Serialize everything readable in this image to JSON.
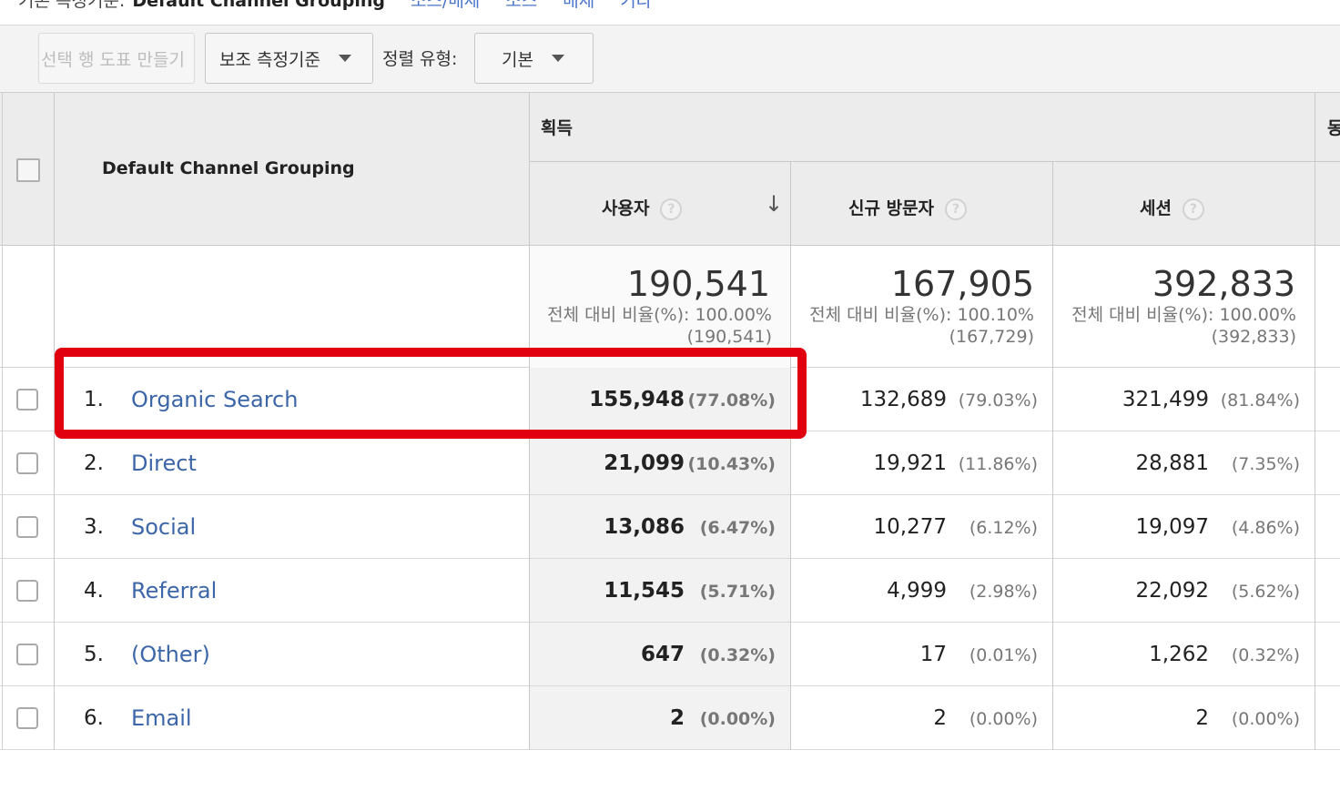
{
  "breadcrumb": {
    "label": "기본 측정기준:",
    "value": "Default Channel Grouping",
    "links": [
      "소스/매체",
      "소스",
      "매체",
      "기타"
    ]
  },
  "toolbar": {
    "plot_rows_label": "선택 행 도표 만들기",
    "secondary_dim_label": "보조 측정기준",
    "sort_type_label": "정렬 유형:",
    "sort_type_value": "기본"
  },
  "table": {
    "dimension_header": "Default Channel Grouping",
    "group_header": "획득",
    "next_group_header": "동",
    "columns": [
      "사용자",
      "신규 방문자",
      "세션"
    ],
    "totals": [
      {
        "value": "190,541",
        "pct_line": "전체 대비 비율(%): 100.00%",
        "abs_line": "(190,541)"
      },
      {
        "value": "167,905",
        "pct_line": "전체 대비 비율(%): 100.10%",
        "abs_line": "(167,729)"
      },
      {
        "value": "392,833",
        "pct_line": "전체 대비 비율(%): 100.00%",
        "abs_line": "(392,833)"
      }
    ],
    "rows": [
      {
        "num": "1.",
        "channel": "Organic Search",
        "users": "155,948",
        "users_pct": "(77.08%)",
        "new": "132,689",
        "new_pct": "(79.03%)",
        "sessions": "321,499",
        "sessions_pct": "(81.84%)"
      },
      {
        "num": "2.",
        "channel": "Direct",
        "users": "21,099",
        "users_pct": "(10.43%)",
        "new": "19,921",
        "new_pct": "(11.86%)",
        "sessions": "28,881",
        "sessions_pct": "(7.35%)"
      },
      {
        "num": "3.",
        "channel": "Social",
        "users": "13,086",
        "users_pct": "(6.47%)",
        "new": "10,277",
        "new_pct": "(6.12%)",
        "sessions": "19,097",
        "sessions_pct": "(4.86%)"
      },
      {
        "num": "4.",
        "channel": "Referral",
        "users": "11,545",
        "users_pct": "(5.71%)",
        "new": "4,999",
        "new_pct": "(2.98%)",
        "sessions": "22,092",
        "sessions_pct": "(5.62%)"
      },
      {
        "num": "5.",
        "channel": "(Other)",
        "users": "647",
        "users_pct": "(0.32%)",
        "new": "17",
        "new_pct": "(0.01%)",
        "sessions": "1,262",
        "sessions_pct": "(0.32%)"
      },
      {
        "num": "6.",
        "channel": "Email",
        "users": "2",
        "users_pct": "(0.00%)",
        "new": "2",
        "new_pct": "(0.00%)",
        "sessions": "2",
        "sessions_pct": "(0.00%)"
      }
    ]
  },
  "icons": {
    "help": "?",
    "sort_desc": "↓"
  },
  "colors": {
    "link": "#3c66a8",
    "highlight": "#e0000f",
    "header_bg": "#ececec"
  }
}
